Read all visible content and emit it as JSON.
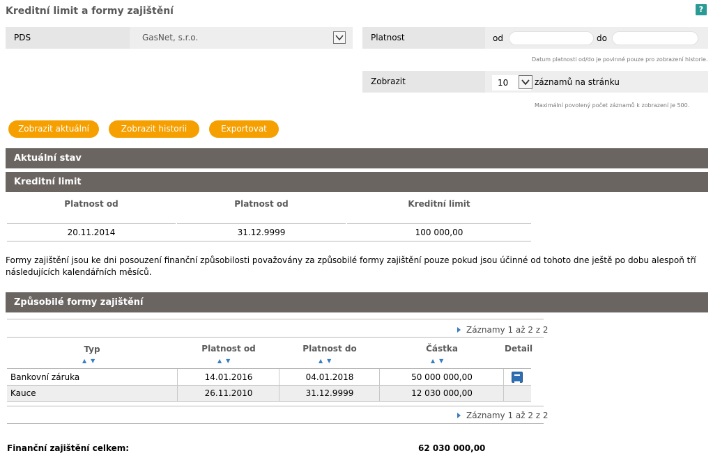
{
  "page": {
    "title": "Kreditní limit a formy zajištění",
    "help": "?"
  },
  "filters": {
    "pds_label": "PDS",
    "pds_value": "GasNet, s.r.o.",
    "validity_label": "Platnost",
    "from_label": "od",
    "to_label": "do",
    "from_value": "",
    "to_value": "",
    "validity_note": "Datum platnosti od/do je povinné pouze pro zobrazení historie.",
    "show_label": "Zobrazit",
    "per_page_value": "10",
    "per_page_suffix": "záznamů na stránku",
    "max_note": "Maximální povolený počet záznamů k zobrazení je 500."
  },
  "buttons": {
    "current": "Zobrazit aktuální",
    "history": "Zobrazit historii",
    "export": "Exportovat"
  },
  "sections": {
    "current_state": "Aktuální stav",
    "credit_limit": "Kreditní limit",
    "eligible_forms": "Způsobilé formy zajištění"
  },
  "credit_table": {
    "headers": [
      "Platnost od",
      "Platnost od",
      "Kreditní limit"
    ],
    "row": [
      "20.11.2014",
      "31.12.9999",
      "100 000,00"
    ]
  },
  "info_text": "Formy zajištění jsou ke dni posouzení finanční způsobilosti považovány za způsobilé formy zajištění pouze pokud jsou účinné od tohoto dne ještě po dobu alespoň tří následujících kalendářních měsíců.",
  "pager": {
    "top": "Záznamy 1 až 2 z 2",
    "bottom": "Záznamy 1 až 2 z 2"
  },
  "forms_table": {
    "headers": [
      "Typ",
      "Platnost od",
      "Platnost do",
      "Částka",
      "Detail"
    ],
    "rows": [
      [
        "Bankovní záruka",
        "14.01.2016",
        "04.01.2018",
        "50 000 000,00"
      ],
      [
        "Kauce",
        "26.11.2010",
        "31.12.9999",
        "12 030 000,00"
      ]
    ]
  },
  "total": {
    "label": "Finanční zajištění celkem:",
    "value": "62 030 000,00"
  },
  "colors": {
    "accent": "#f5a000",
    "section_bar": "#6b6562",
    "help": "#2a9a94",
    "link": "#3a7cc0"
  }
}
